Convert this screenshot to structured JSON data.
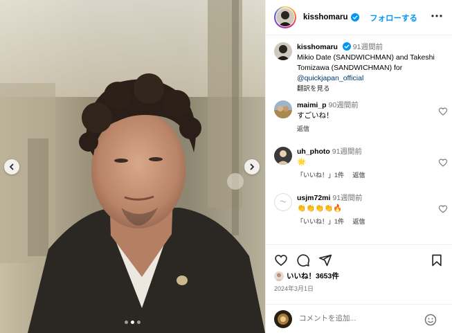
{
  "header": {
    "username": "kisshomaru",
    "follow_label": "フォローする",
    "more_icon": "more-horizontal-icon",
    "verified_color": "#0095f6"
  },
  "caption": {
    "username": "kisshomaru",
    "time": "91週間前",
    "text": "Mikio Date (SANDWICHMAN) and Takeshi Tomizawa (SANDWICHMAN) for",
    "mention": "@quickjapan_official",
    "see_translation": "翻訳を見る"
  },
  "comments": [
    {
      "username": "maimi_p",
      "time": "90週間前",
      "text": "すごいね！",
      "reply": "返信",
      "likes": ""
    },
    {
      "username": "uh_photo",
      "time": "91週間前",
      "text": "🌟",
      "reply": "返信",
      "likes": "「いいね！」1件"
    },
    {
      "username": "usjm72mi",
      "time": "91週間前",
      "text": "👏👏👏👏🔥",
      "reply": "返信",
      "likes": "「いいね！」1件"
    }
  ],
  "actions": {
    "likes": "いいね！3653件",
    "date": "2024年3月1日",
    "add_comment_placeholder": "コメントを追加..."
  },
  "carousel": {
    "total": 3,
    "active": 2
  },
  "colors": {
    "accent": "#0095f6",
    "muted": "#737373",
    "link": "#00376b",
    "border": "#efefef"
  }
}
